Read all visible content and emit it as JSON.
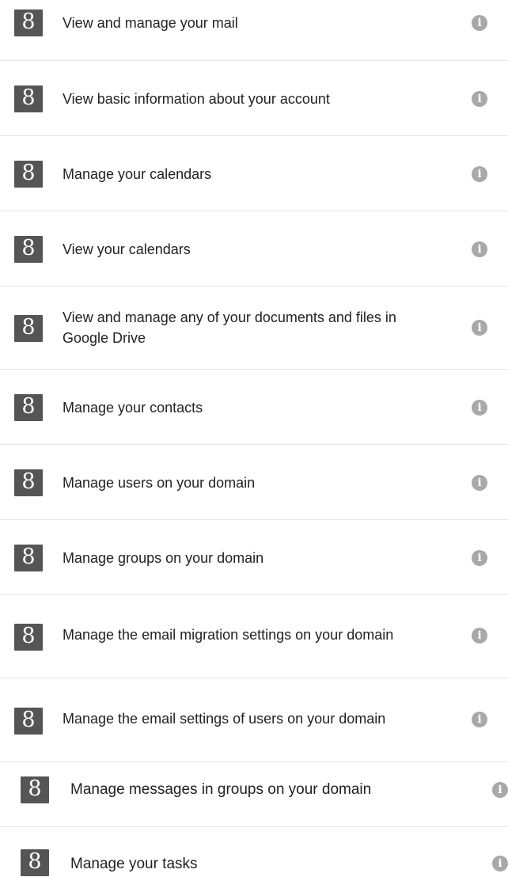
{
  "icon_glyph": "8",
  "info_glyph": "i",
  "colors": {
    "icon_bg": "#555555",
    "info_bg": "#a8a8a8",
    "divider": "#e5e5e5",
    "text": "#222222"
  },
  "permissions": [
    {
      "label": "View and manage your mail",
      "icon": "google-icon"
    },
    {
      "label": "View basic information about your account",
      "icon": "google-icon"
    },
    {
      "label": "Manage your calendars",
      "icon": "google-icon"
    },
    {
      "label": "View your calendars",
      "icon": "google-icon"
    },
    {
      "label": "View and manage any of your documents and files in Google Drive",
      "icon": "google-icon"
    },
    {
      "label": "Manage your contacts",
      "icon": "google-icon"
    },
    {
      "label": "Manage users on your domain",
      "icon": "google-icon"
    },
    {
      "label": "Manage groups on your domain",
      "icon": "google-icon"
    },
    {
      "label": "Manage the email migration settings on your domain",
      "icon": "google-icon"
    },
    {
      "label": "Manage the email settings of users on your domain",
      "icon": "google-icon"
    },
    {
      "label": "Manage messages in groups on your domain",
      "icon": "google-icon"
    },
    {
      "label": "Manage your tasks",
      "icon": "google-icon"
    }
  ]
}
